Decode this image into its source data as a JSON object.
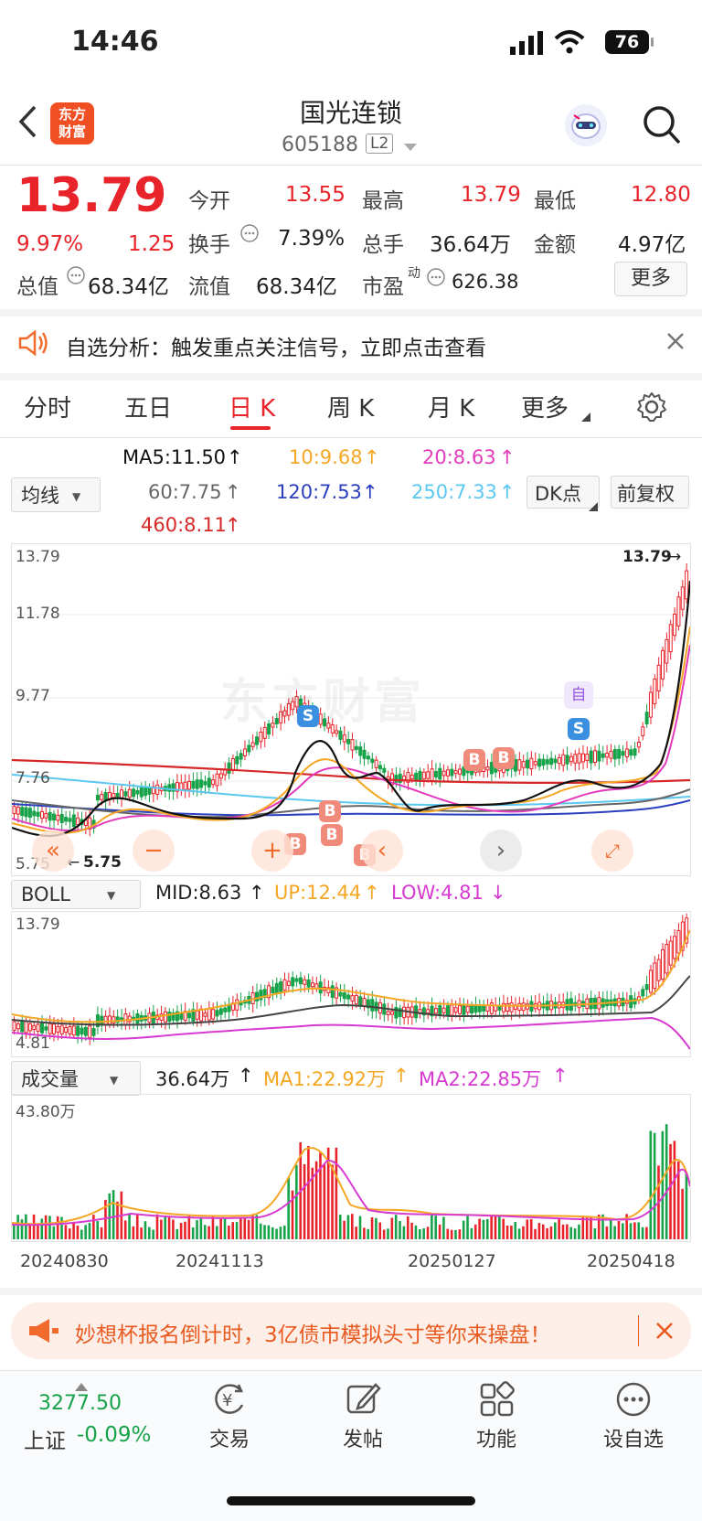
{
  "status": {
    "time": "14:46",
    "battery": "76"
  },
  "header": {
    "logo_line1": "东方",
    "logo_line2": "财富",
    "title": "国光连锁",
    "code": "605188",
    "level": "L2"
  },
  "quote": {
    "price": "13.79",
    "pct": "9.97%",
    "change": "1.25",
    "open_lbl": "今开",
    "open": "13.55",
    "high_lbl": "最高",
    "high": "13.79",
    "low_lbl": "最低",
    "low": "12.80",
    "turn_lbl": "换手",
    "turn": "7.39%",
    "vol_lbl": "总手",
    "vol": "36.64万",
    "amt_lbl": "金额",
    "amt": "4.97亿",
    "mcap_lbl": "总值",
    "mcap": "68.34亿",
    "float_lbl": "流值",
    "float": "68.34亿",
    "pe_lbl": "市盈",
    "pe_sup": "动",
    "pe": "626.38",
    "more": "更多"
  },
  "notice": {
    "text": "自选分析：触发重点关注信号，立即点击查看"
  },
  "tabs": [
    "分时",
    "五日",
    "日 K",
    "周 K",
    "月 K",
    "更多"
  ],
  "ma": {
    "selector": "均线",
    "ma5": "MA5:11.50",
    "ma10": "10:9.68",
    "ma20": "20:8.63",
    "ma60": "60:7.75",
    "ma120": "120:7.53",
    "ma250": "250:7.33",
    "ma460": "460:8.11",
    "dk": "DK点",
    "fq": "前复权"
  },
  "main_chart": {
    "y_labels": [
      "13.79",
      "11.78",
      "9.77",
      "7.76",
      "5.75"
    ],
    "max_label": "13.79",
    "min_label": "5.75",
    "watermark": "东方财富",
    "signals": {
      "s": "S",
      "b": "B",
      "zi": "自"
    }
  },
  "boll": {
    "selector": "BOLL",
    "mid": "MID:8.63",
    "up": "UP:12.44",
    "low": "LOW:4.81",
    "y_top": "13.79",
    "y_bot": "4.81"
  },
  "volume": {
    "selector": "成交量",
    "vol": "36.64万",
    "ma1": "MA1:22.92万",
    "ma2": "MA2:22.85万",
    "y_top": "43.80万"
  },
  "dates": [
    "20240830",
    "20241113",
    "20250127",
    "20250418"
  ],
  "banner": {
    "text": "妙想杯报名倒计时，3亿债市模拟头寸等你来操盘！"
  },
  "dock": {
    "index_val": "3277.50",
    "index_name": "上证",
    "index_pct": "-0.09%",
    "items": [
      "交易",
      "发帖",
      "功能",
      "设自选"
    ]
  },
  "colors": {
    "red": "#e8232a",
    "green": "#16a34a",
    "ma5": "#111111",
    "ma10": "#f5a623",
    "ma20": "#e23cbd",
    "ma60": "#666666",
    "ma120": "#2b3fbf",
    "ma250": "#5ac8f0",
    "ma460": "#d62828"
  }
}
